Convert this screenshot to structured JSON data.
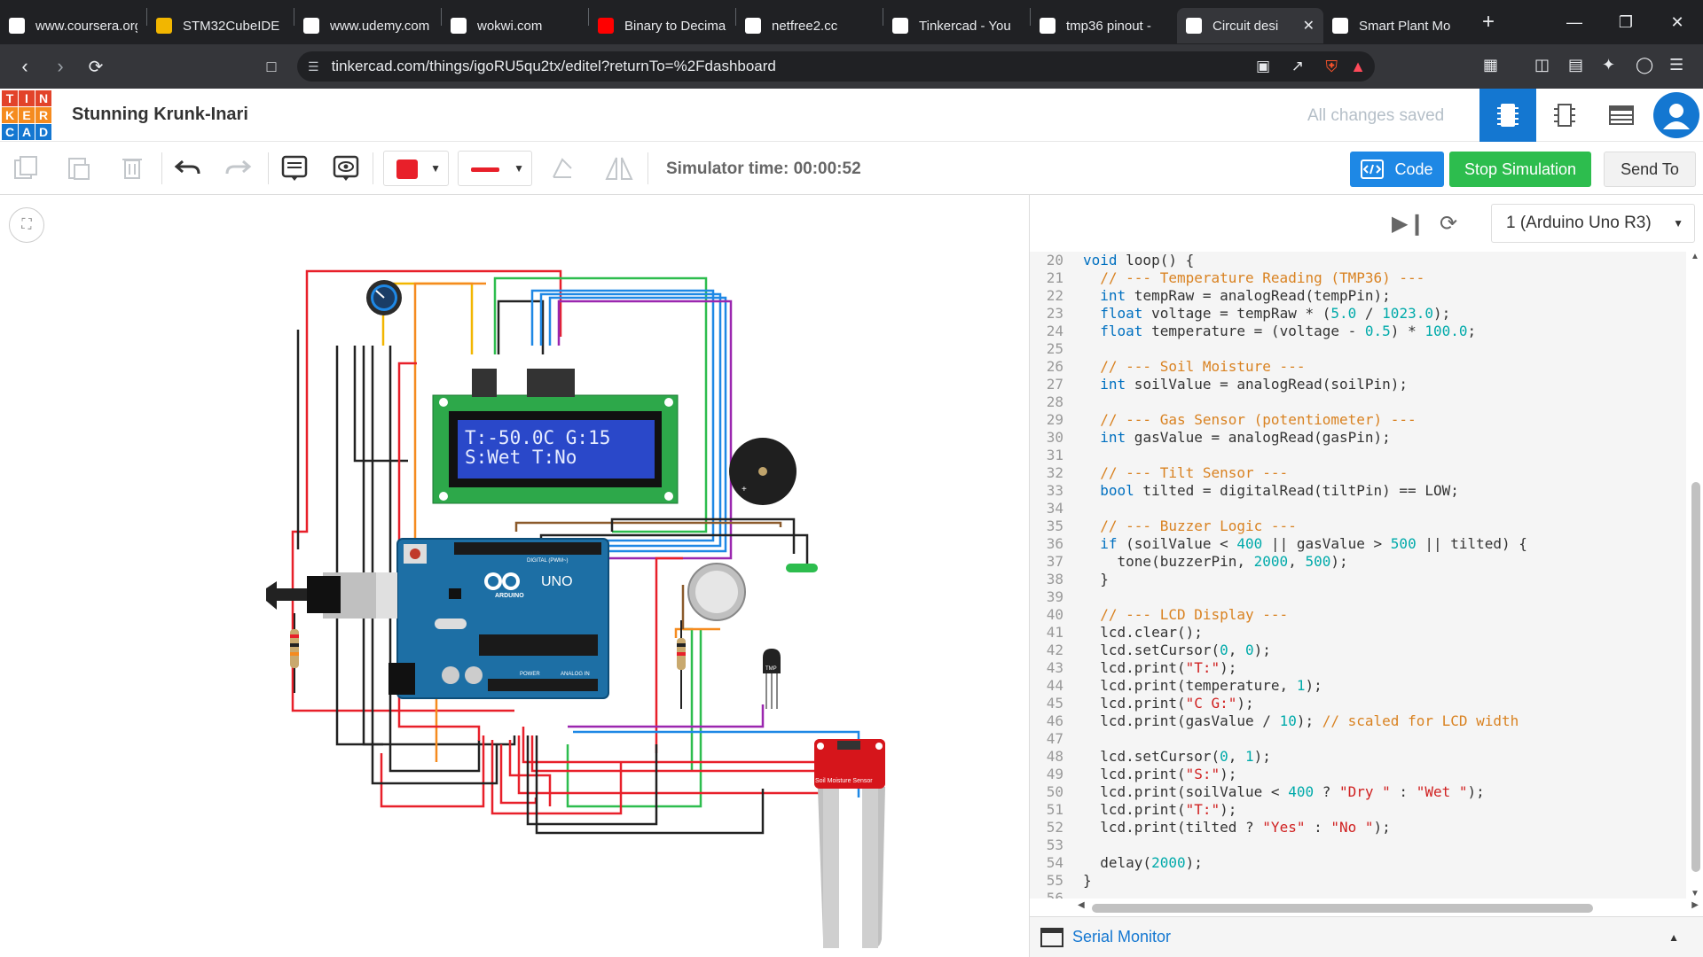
{
  "browser": {
    "tabs": [
      {
        "title": "www.coursera.org",
        "icon": "coursera-icon",
        "color": "#ffffff"
      },
      {
        "title": "STM32CubeIDE",
        "icon": "st-icon",
        "color": "#f2b600"
      },
      {
        "title": "www.udemy.com",
        "icon": "udemy-icon",
        "color": "#ffffff"
      },
      {
        "title": "wokwi.com",
        "icon": "wokwi-icon",
        "color": "#ffffff"
      },
      {
        "title": "Binary to Decimal",
        "icon": "youtube-icon",
        "color": "#ff0000"
      },
      {
        "title": "netfree2.cc",
        "icon": "netfree-icon",
        "color": "#ffffff"
      },
      {
        "title": "Tinkercad - You",
        "icon": "tinkercad-icon",
        "color": "#ffffff"
      },
      {
        "title": "tmp36 pinout -",
        "icon": "google-icon",
        "color": "#ffffff"
      },
      {
        "title": "Circuit desi",
        "icon": "tinkercad-icon",
        "color": "#ffffff",
        "active": true
      },
      {
        "title": "Smart Plant Mo",
        "icon": "chatgpt-icon",
        "color": "#ffffff"
      }
    ],
    "url": "tinkercad.com/things/igoRU5qu2tx/editel?returnTo=%2Fdashboard"
  },
  "header": {
    "logo_letters": [
      "T",
      "I",
      "N",
      "K",
      "E",
      "R",
      "C",
      "A",
      "D"
    ],
    "logo_colors": [
      "#e2432a",
      "#e2432a",
      "#e2432a",
      "#f58b1f",
      "#f58b1f",
      "#f58b1f",
      "#1477d1",
      "#1477d1",
      "#1477d1"
    ],
    "design_title": "Stunning Krunk-Inari",
    "save_status": "All changes saved"
  },
  "toolbar": {
    "sim_time": "Simulator time: 00:00:52",
    "code_label": "Code",
    "stop_label": "Stop Simulation",
    "send_label": "Send To",
    "wire_color": "#e8202a"
  },
  "circuit": {
    "lcd_line1": "T:-50.0C G:15",
    "lcd_line2": "S:Wet T:No",
    "uno_label": "UNO",
    "arduino_label": "ARDUINO",
    "digital_label": "DIGITAL (PWM~)",
    "power_label": "POWER",
    "analog_label": "ANALOG IN",
    "tmp_label": "TMP",
    "soil_label": "Soil Moisture Sensor"
  },
  "code_panel": {
    "board": "1 (Arduino Uno R3)",
    "serial_label": "Serial Monitor",
    "lines": [
      {
        "n": "20",
        "html": "<span class='kw'>void</span> loop() {"
      },
      {
        "n": "21",
        "html": "  <span class='cm'>// --- Temperature Reading (TMP36) ---</span>"
      },
      {
        "n": "22",
        "html": "  <span class='kw'>int</span> tempRaw = analogRead(tempPin);"
      },
      {
        "n": "23",
        "html": "  <span class='kw'>float</span> voltage = tempRaw * (<span class='num'>5.0</span> / <span class='num'>1023.0</span>);"
      },
      {
        "n": "24",
        "html": "  <span class='kw'>float</span> temperature = (voltage - <span class='num'>0.5</span>) * <span class='num'>100.0</span>;"
      },
      {
        "n": "25",
        "html": ""
      },
      {
        "n": "26",
        "html": "  <span class='cm'>// --- Soil Moisture ---</span>"
      },
      {
        "n": "27",
        "html": "  <span class='kw'>int</span> soilValue = analogRead(soilPin);"
      },
      {
        "n": "28",
        "html": ""
      },
      {
        "n": "29",
        "html": "  <span class='cm'>// --- Gas Sensor (potentiometer) ---</span>"
      },
      {
        "n": "30",
        "html": "  <span class='kw'>int</span> gasValue = analogRead(gasPin);"
      },
      {
        "n": "31",
        "html": ""
      },
      {
        "n": "32",
        "html": "  <span class='cm'>// --- Tilt Sensor ---</span>"
      },
      {
        "n": "33",
        "html": "  <span class='kw'>bool</span> tilted = digitalRead(tiltPin) == LOW;"
      },
      {
        "n": "34",
        "html": ""
      },
      {
        "n": "35",
        "html": "  <span class='cm'>// --- Buzzer Logic ---</span>"
      },
      {
        "n": "36",
        "html": "  <span class='kw'>if</span> (soilValue &lt; <span class='num'>400</span> || gasValue &gt; <span class='num'>500</span> || tilted) {"
      },
      {
        "n": "37",
        "html": "    tone(buzzerPin, <span class='num'>2000</span>, <span class='num'>500</span>);"
      },
      {
        "n": "38",
        "html": "  }"
      },
      {
        "n": "39",
        "html": ""
      },
      {
        "n": "40",
        "html": "  <span class='cm'>// --- LCD Display ---</span>"
      },
      {
        "n": "41",
        "html": "  lcd.clear();"
      },
      {
        "n": "42",
        "html": "  lcd.setCursor(<span class='num'>0</span>, <span class='num'>0</span>);"
      },
      {
        "n": "43",
        "html": "  lcd.print(<span class='str'>\"T:\"</span>);"
      },
      {
        "n": "44",
        "html": "  lcd.print(temperature, <span class='num'>1</span>);"
      },
      {
        "n": "45",
        "html": "  lcd.print(<span class='str'>\"C G:\"</span>);"
      },
      {
        "n": "46",
        "html": "  lcd.print(gasValue / <span class='num'>10</span>); <span class='cm'>// scaled for LCD width</span>"
      },
      {
        "n": "47",
        "html": ""
      },
      {
        "n": "48",
        "html": "  lcd.setCursor(<span class='num'>0</span>, <span class='num'>1</span>);"
      },
      {
        "n": "49",
        "html": "  lcd.print(<span class='str'>\"S:\"</span>);"
      },
      {
        "n": "50",
        "html": "  lcd.print(soilValue &lt; <span class='num'>400</span> ? <span class='str'>\"Dry \"</span> : <span class='str'>\"Wet \"</span>);"
      },
      {
        "n": "51",
        "html": "  lcd.print(<span class='str'>\"T:\"</span>);"
      },
      {
        "n": "52",
        "html": "  lcd.print(tilted ? <span class='str'>\"Yes\"</span> : <span class='str'>\"No \"</span>);"
      },
      {
        "n": "53",
        "html": ""
      },
      {
        "n": "54",
        "html": "  delay(<span class='num'>2000</span>);"
      },
      {
        "n": "55",
        "html": "}"
      },
      {
        "n": "56",
        "html": ""
      }
    ]
  }
}
